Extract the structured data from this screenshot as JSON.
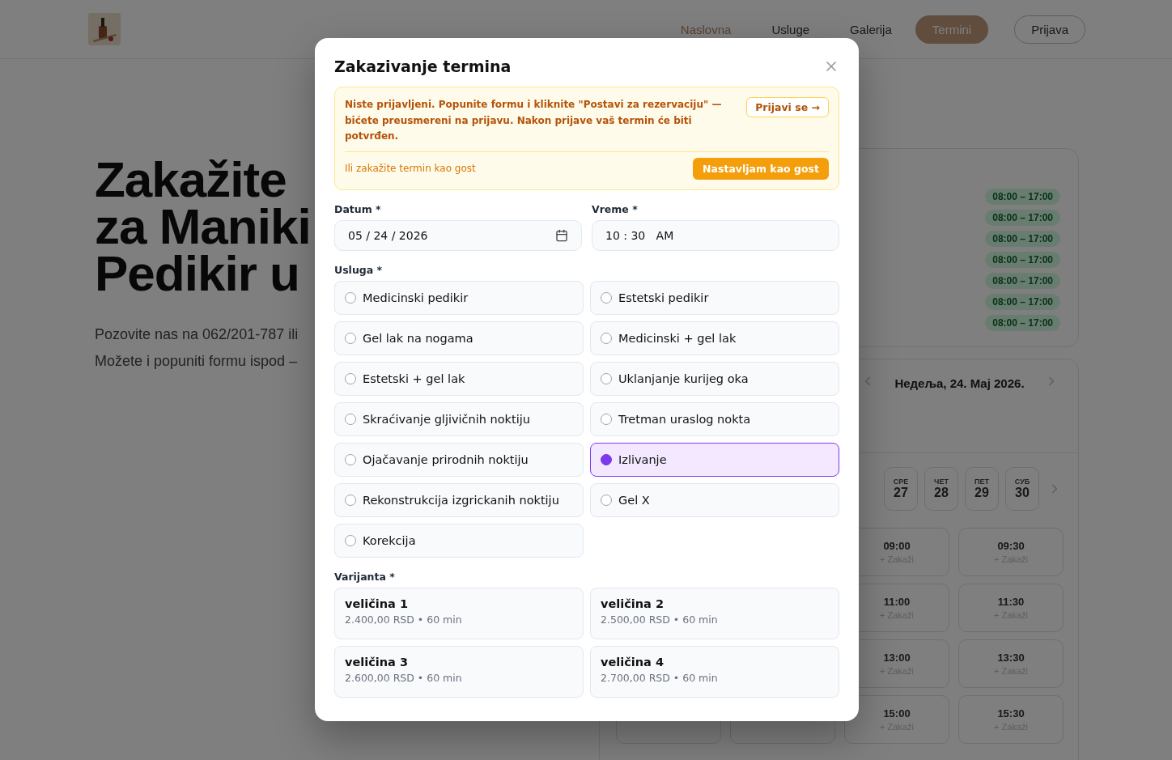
{
  "header": {
    "nav": [
      {
        "label": "Naslovna",
        "kind": "link",
        "accent": true,
        "selected": false
      },
      {
        "label": "Usluge",
        "kind": "link",
        "accent": false,
        "selected": false
      },
      {
        "label": "Galerija",
        "kind": "link",
        "accent": false,
        "selected": false
      },
      {
        "label": "Termini",
        "kind": "link",
        "accent": false,
        "selected": true
      },
      {
        "label": "Prijava",
        "kind": "outline",
        "accent": false,
        "selected": false
      }
    ]
  },
  "hero": {
    "title_lines": [
      "Zakažite",
      "za Maniki",
      "Pedikir u"
    ],
    "paragraph_lines": [
      "Pozovite nas na 062/201-787 ili",
      "Možete i popuniti formu ispod –"
    ]
  },
  "hours": {
    "pills": [
      "08:00 – 17:00",
      "08:00 – 17:00",
      "08:00 – 17:00",
      "08:00 – 17:00",
      "08:00 – 17:00",
      "08:00 – 17:00",
      "08:00 – 17:00"
    ]
  },
  "calendar": {
    "date_title": "Недеља, 24. Мај 2026.",
    "days": [
      {
        "dow": "СРЕ",
        "day": "27"
      },
      {
        "dow": "ЧЕТ",
        "day": "28"
      },
      {
        "dow": "ПЕТ",
        "day": "29"
      },
      {
        "dow": "СУБ",
        "day": "30"
      }
    ],
    "slot_rows": [
      [
        {
          "time": "09:00",
          "action": "+ Zakaži"
        },
        {
          "time": "09:30",
          "action": "+ Zakaži"
        }
      ],
      [
        {
          "time": "11:00",
          "action": "+ Zakaži"
        },
        {
          "time": "11:30",
          "action": "+ Zakaži"
        }
      ],
      [
        {
          "time": "13:00",
          "action": "+ Zakaži"
        },
        {
          "time": "13:30",
          "action": "+ Zakaži"
        }
      ],
      [
        {
          "time": "15:00",
          "action": "+ Zakaži"
        },
        {
          "time": "15:30",
          "action": "+ Zakaži"
        }
      ]
    ]
  },
  "modal": {
    "title": "Zakazivanje termina",
    "alert": {
      "message": "Niste prijavljeni. Popunite formu i kliknite \"Postavi za rezervaciju\" — bićete preusmereni na prijavu. Nakon prijave vaš termin će biti potvrđen.",
      "login_button": "Prijavi se →",
      "guest_text": "Ili zakažite termin kao gost",
      "guest_button": "Nastavljam kao gost"
    },
    "fields": [
      {
        "label": "Datum *",
        "value": "05 / 24 / 2026",
        "kind": "date"
      },
      {
        "label": "Vreme *",
        "value": "10 : 30   AM",
        "kind": "time"
      }
    ],
    "service_label": "Usluga *",
    "services": [
      {
        "label": "Medicinski pedikir",
        "selected": false
      },
      {
        "label": "Estetski pedikir",
        "selected": false
      },
      {
        "label": "Gel lak na nogama",
        "selected": false
      },
      {
        "label": "Medicinski + gel lak",
        "selected": false
      },
      {
        "label": "Estetski + gel lak",
        "selected": false
      },
      {
        "label": "Uklanjanje kurijeg oka",
        "selected": false
      },
      {
        "label": "Skraćivanje gljivičnih noktiju",
        "selected": false
      },
      {
        "label": "Tretman uraslog nokta",
        "selected": false
      },
      {
        "label": "Ojačavanje prirodnih noktiju",
        "selected": false
      },
      {
        "label": "Izlivanje",
        "selected": true
      },
      {
        "label": "Rekonstrukcija izgrickanih noktiju",
        "selected": false
      },
      {
        "label": "Gel X",
        "selected": false
      },
      {
        "label": "Korekcija",
        "selected": false
      }
    ],
    "variant_label": "Varijanta *",
    "variants": [
      {
        "name": "veličina 1",
        "detail": "2.400,00 RSD • 60 min"
      },
      {
        "name": "veličina 2",
        "detail": "2.500,00 RSD • 60 min"
      },
      {
        "name": "veličina 3",
        "detail": "2.600,00 RSD • 60 min"
      },
      {
        "name": "veličina 4",
        "detail": "2.700,00 RSD • 60 min"
      }
    ]
  }
}
